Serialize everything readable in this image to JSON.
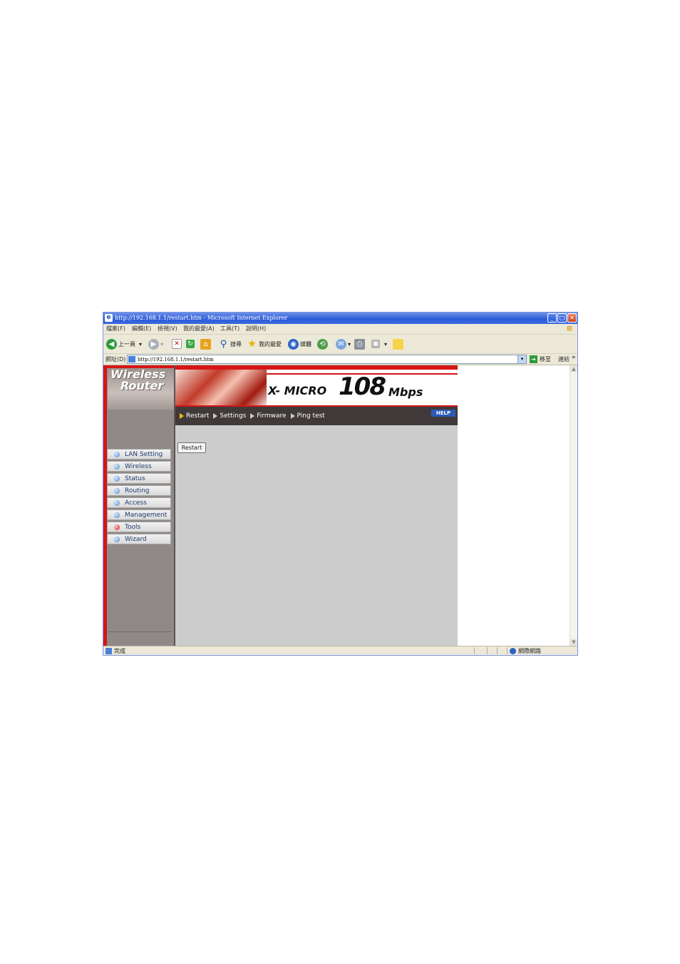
{
  "window": {
    "title": "http://192.168.1.1/restart.htm - Microsoft Internet Explorer",
    "controls": {
      "minimize": "_",
      "maximize": "□",
      "close": "✕"
    }
  },
  "menu": [
    "檔案(F)",
    "編輯(E)",
    "檢視(V)",
    "我的最愛(A)",
    "工具(T)",
    "說明(H)"
  ],
  "toolbar": {
    "back": "上一頁",
    "search": "搜尋",
    "favorites": "我的最愛",
    "media": "媒體"
  },
  "address": {
    "label": "網址(D)",
    "url": "http://192.168.1.1/restart.htm",
    "go_label": "移至",
    "links_label": "連結",
    "more": "»"
  },
  "brand": {
    "line1": "Wireless",
    "line2": "Router"
  },
  "banner": {
    "prefix": "X- MICRO",
    "number": "108",
    "suffix": "Mbps"
  },
  "subnav": {
    "items": [
      "Restart",
      "Settings",
      "Firmware",
      "Ping test"
    ],
    "help": "HELP"
  },
  "nav": {
    "items": [
      "LAN Setting",
      "Wireless",
      "Status",
      "Routing",
      "Access",
      "Management",
      "Tools",
      "Wizard"
    ],
    "active": "Tools"
  },
  "main": {
    "restart_button": "Restart"
  },
  "status": {
    "text": "完成",
    "zone": "網際網路"
  },
  "colors": {
    "accent_red": "#d61616",
    "panel_gray": "#8f8a87",
    "content_gray": "#cccccc",
    "dark_bar": "#3f3a39"
  }
}
